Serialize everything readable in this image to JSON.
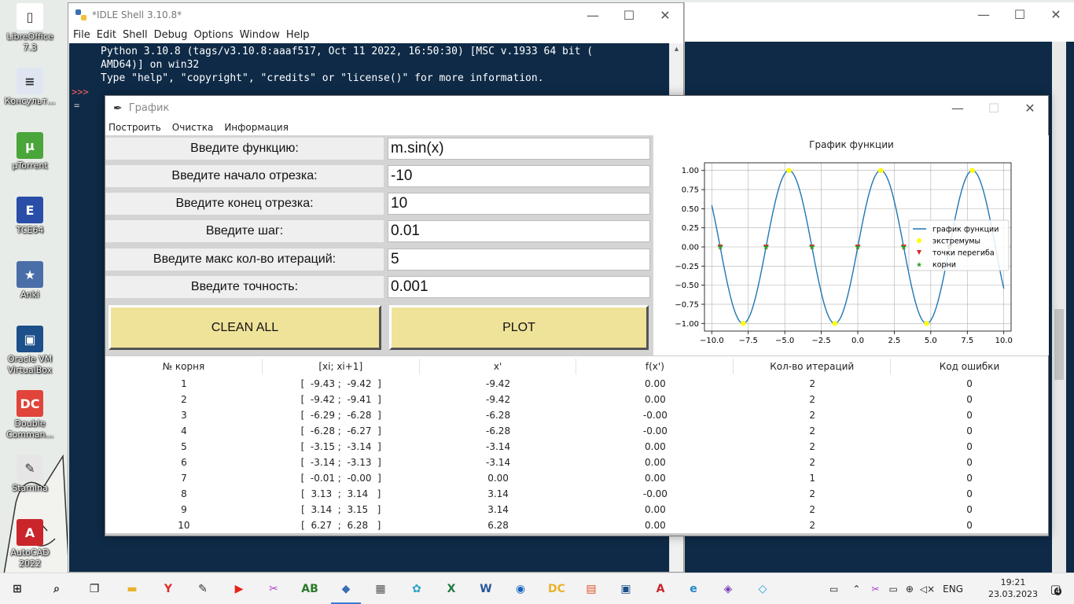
{
  "desktop": {
    "icons": [
      {
        "label": "LibreOffice 7.3",
        "glyph": "▯",
        "color": "#ffffff"
      },
      {
        "label": "Консульт...",
        "glyph": "≡",
        "color": "#dfe6f2"
      },
      {
        "label": "µTorrent",
        "glyph": "µ",
        "color": "#4aa53a"
      },
      {
        "label": "TCE64",
        "glyph": "E",
        "color": "#2a4ea8"
      },
      {
        "label": "Anki",
        "glyph": "★",
        "color": "#4a6fa8"
      },
      {
        "label": "Oracle VM VirtualBox",
        "glyph": "▣",
        "color": "#1d4f8a"
      },
      {
        "label": "Double Comman...",
        "glyph": "DC",
        "color": "#e0443a"
      },
      {
        "label": "Stamina",
        "glyph": "✎",
        "color": "#e6e6e6"
      },
      {
        "label": "AutoCAD 2022",
        "glyph": "A",
        "color": "#c9252b"
      }
    ]
  },
  "idle": {
    "title": "*IDLE Shell 3.10.8*",
    "menu": [
      "File",
      "Edit",
      "Shell",
      "Debug",
      "Options",
      "Window",
      "Help"
    ],
    "prompt": ">>>",
    "eq": "=",
    "lines": [
      "Python 3.10.8 (tags/v3.10.8:aaaf517, Oct 11 2022, 16:50:30) [MSC v.1933 64 bit (",
      "AMD64)] on win32",
      "Type \"help\", \"copyright\", \"credits\" or \"license()\" for more information."
    ]
  },
  "caption": {
    "minimize": "—",
    "maximize": "☐",
    "close": "✕"
  },
  "graph": {
    "title": "График",
    "menu": [
      "Построить",
      "Очистка",
      "Информация"
    ],
    "form": [
      {
        "label": "Введите функцию:",
        "value": "m.sin(x)"
      },
      {
        "label": "Введите начало отрезка:",
        "value": "-10"
      },
      {
        "label": "Введите конец отрезка:",
        "value": "10"
      },
      {
        "label": "Введите шаг:",
        "value": "0.01"
      },
      {
        "label": "Введите макс кол-во итераций:",
        "value": "5"
      },
      {
        "label": "Введите точность:",
        "value": "0.001"
      }
    ],
    "buttons": {
      "clean": "CLEAN ALL",
      "plot": "PLOT"
    },
    "table": {
      "headers": [
        "№ корня",
        "[xi; xi+1]",
        "x'",
        "f(x')",
        "Кол-во итераций",
        "Код ошибки"
      ],
      "rows": [
        [
          "1",
          "[  -9.43 ;  -9.42  ]",
          "-9.42",
          "0.00",
          "2",
          "0"
        ],
        [
          "2",
          "[  -9.42 ;  -9.41  ]",
          "-9.42",
          "0.00",
          "2",
          "0"
        ],
        [
          "3",
          "[  -6.29 ;  -6.28  ]",
          "-6.28",
          "-0.00",
          "2",
          "0"
        ],
        [
          "4",
          "[  -6.28 ;  -6.27  ]",
          "-6.28",
          "-0.00",
          "2",
          "0"
        ],
        [
          "5",
          "[  -3.15 ;  -3.14  ]",
          "-3.14",
          "0.00",
          "2",
          "0"
        ],
        [
          "6",
          "[  -3.14 ;  -3.13  ]",
          "-3.14",
          "0.00",
          "2",
          "0"
        ],
        [
          "7",
          "[  -0.01 ;  -0.00  ]",
          "0.00",
          "0.00",
          "1",
          "0"
        ],
        [
          "8",
          "[  3.13  ;  3.14   ]",
          "3.14",
          "-0.00",
          "2",
          "0"
        ],
        [
          "9",
          "[  3.14  ;  3.15   ]",
          "3.14",
          "0.00",
          "2",
          "0"
        ],
        [
          "10",
          "[  6.27  ;  6.28   ]",
          "6.28",
          "0.00",
          "2",
          "0"
        ]
      ]
    }
  },
  "chart_data": {
    "type": "line",
    "title": "График функции",
    "xlabel": "",
    "ylabel": "",
    "xlim": [
      -10.5,
      10.5
    ],
    "ylim": [
      -1.1,
      1.1
    ],
    "xticks": [
      -10.0,
      -7.5,
      -5.0,
      -2.5,
      0.0,
      2.5,
      5.0,
      7.5,
      10.0
    ],
    "xtick_labels": [
      "−10.0",
      "−7.5",
      "−5.0",
      "−2.5",
      "0.0",
      "2.5",
      "5.0",
      "7.5",
      "10.0"
    ],
    "yticks": [
      1.0,
      0.75,
      0.5,
      0.25,
      0.0,
      -0.25,
      -0.5,
      -0.75,
      -1.0
    ],
    "ytick_labels": [
      "1.00",
      "0.75",
      "0.50",
      "0.25",
      "0.00",
      "−0.25",
      "−0.50",
      "−0.75",
      "−1.00"
    ],
    "grid": true,
    "legend_position": "center-right",
    "series": [
      {
        "name": "график функции",
        "kind": "line",
        "function": "sin(x)",
        "x_range": [
          -10,
          10
        ],
        "color": "#1f77b4"
      },
      {
        "name": "экстремумы",
        "kind": "scatter",
        "marker": "circle",
        "color": "#ffff00",
        "x": [
          -7.85,
          -4.71,
          -1.57,
          1.57,
          4.71,
          7.85
        ],
        "y": [
          -1,
          1,
          -1,
          1,
          -1,
          1
        ]
      },
      {
        "name": "точки перегиба",
        "kind": "scatter",
        "marker": "triangle-down",
        "color": "#d62728",
        "x": [
          -9.42,
          -6.28,
          -3.14,
          0.0,
          3.14,
          6.28
        ],
        "y": [
          0,
          0,
          0,
          0,
          0,
          0
        ]
      },
      {
        "name": "корни",
        "kind": "scatter",
        "marker": "star",
        "color": "#2ca02c",
        "x": [
          -9.42,
          -6.28,
          -3.14,
          0.0,
          3.14,
          6.28
        ],
        "y": [
          0,
          0,
          0,
          0,
          0,
          0
        ]
      }
    ]
  },
  "taskbar": {
    "apps": [
      {
        "name": "start",
        "glyph": "⊞",
        "color": "#1e1e1e"
      },
      {
        "name": "search",
        "glyph": "⌕",
        "color": "#1e1e1e"
      },
      {
        "name": "task-view",
        "glyph": "❐",
        "color": "#1e1e1e"
      },
      {
        "name": "explorer",
        "glyph": "▬",
        "color": "#e8b32c"
      },
      {
        "name": "yandex",
        "glyph": "Y",
        "color": "#e02a2a"
      },
      {
        "name": "stamina",
        "glyph": "✎",
        "color": "#333333"
      },
      {
        "name": "youtube",
        "glyph": "▶",
        "color": "#e62117"
      },
      {
        "name": "scissors",
        "glyph": "✂",
        "color": "#b040c8"
      },
      {
        "name": "abnet",
        "glyph": "AB",
        "color": "#2a7a2a"
      },
      {
        "name": "python",
        "glyph": "◆",
        "color": "#3a6fb0"
      },
      {
        "name": "calculator",
        "glyph": "▦",
        "color": "#555555"
      },
      {
        "name": "paint",
        "glyph": "✿",
        "color": "#2aa0c8"
      },
      {
        "name": "excel",
        "glyph": "X",
        "color": "#1d7a3e"
      },
      {
        "name": "word",
        "glyph": "W",
        "color": "#2b579a"
      },
      {
        "name": "app-blue",
        "glyph": "◉",
        "color": "#1565c0"
      },
      {
        "name": "double-commander",
        "glyph": "DC",
        "color": "#e8b32c"
      },
      {
        "name": "slides",
        "glyph": "▤",
        "color": "#e0502a"
      },
      {
        "name": "virtualbox",
        "glyph": "▣",
        "color": "#1d4f8a"
      },
      {
        "name": "autocad",
        "glyph": "A",
        "color": "#c9252b"
      },
      {
        "name": "edge",
        "glyph": "e",
        "color": "#1e88c8"
      },
      {
        "name": "visual-studio",
        "glyph": "◈",
        "color": "#7a3cb8"
      },
      {
        "name": "vscode",
        "glyph": "◇",
        "color": "#1f9ae0"
      }
    ],
    "lang": "ENG",
    "time": "19:21",
    "date": "23.03.2023",
    "notifications": "4"
  }
}
